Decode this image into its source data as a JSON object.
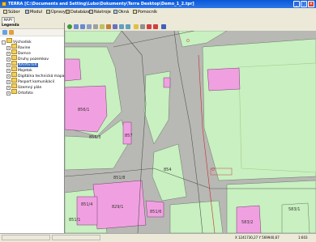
{
  "window": {
    "title": "TERRA [C:\\Documents and Setting\\Lubo\\Dokumenty\\Terra Desktop\\Demo_1_2.tpr]"
  },
  "menu": [
    {
      "label": "Súbor"
    },
    {
      "label": "Modul"
    },
    {
      "label": "Úpravy"
    },
    {
      "label": "Databáza"
    },
    {
      "label": "Nástroje"
    },
    {
      "label": "Okná"
    },
    {
      "label": "Pomocník"
    }
  ],
  "tabs": [
    {
      "label": "MAPY"
    }
  ],
  "legend": {
    "title": "Legenda",
    "items": [
      {
        "label": "Východisk"
      },
      {
        "label": "Ravine"
      },
      {
        "label": "Domce"
      },
      {
        "label": "Druhy pozemkov"
      },
      {
        "label": "KATASTER"
      },
      {
        "label": "Majetok"
      },
      {
        "label": "Digitálna technická mapa"
      },
      {
        "label": "Pasport komunikácií"
      },
      {
        "label": "Územný plán"
      },
      {
        "label": "Ortofoto"
      }
    ]
  },
  "map": {
    "labels": [
      {
        "text": "856/1"
      },
      {
        "text": "856/3"
      },
      {
        "text": "857"
      },
      {
        "text": "854"
      },
      {
        "text": "851/8"
      },
      {
        "text": "851/4"
      },
      {
        "text": "829/1"
      },
      {
        "text": "851/1"
      },
      {
        "text": "851/6"
      },
      {
        "text": "583/2"
      },
      {
        "text": "583/1"
      }
    ]
  },
  "status": {
    "coords": "X 1241730,27 Y 569940,67",
    "scale": "1:603"
  },
  "colors": {
    "parcel_green": "#c8f0c0",
    "building_pink": "#f0a0e0",
    "road_gray": "#b8b8b4",
    "titlebar": "#0a58d8"
  }
}
